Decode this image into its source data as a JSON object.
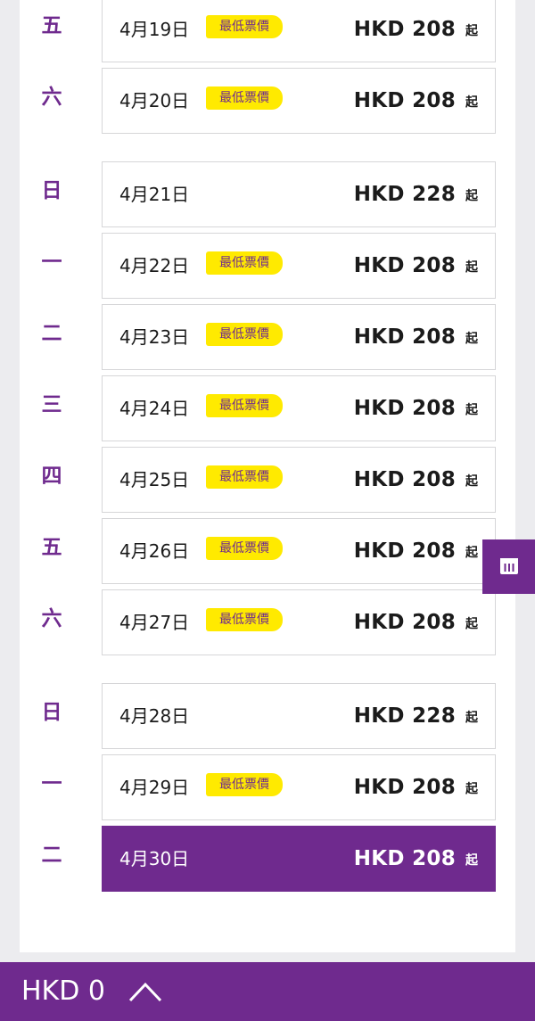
{
  "colors": {
    "brand": "#6f2a8e",
    "badge": "#ffea00",
    "page_bg": "#ececef",
    "card_border": "#d6d6d8"
  },
  "rows": [
    {
      "day": "五",
      "date": "4月19日",
      "badge": "最低票價",
      "price": "HKD 208",
      "suffix": "起"
    },
    {
      "day": "六",
      "date": "4月20日",
      "badge": "最低票價",
      "price": "HKD 208",
      "suffix": "起"
    },
    {
      "day": "日",
      "date": "4月21日",
      "badge": "",
      "price": "HKD 228",
      "suffix": "起"
    },
    {
      "day": "一",
      "date": "4月22日",
      "badge": "最低票價",
      "price": "HKD 208",
      "suffix": "起"
    },
    {
      "day": "二",
      "date": "4月23日",
      "badge": "最低票價",
      "price": "HKD 208",
      "suffix": "起"
    },
    {
      "day": "三",
      "date": "4月24日",
      "badge": "最低票價",
      "price": "HKD 208",
      "suffix": "起"
    },
    {
      "day": "四",
      "date": "4月25日",
      "badge": "最低票價",
      "price": "HKD 208",
      "suffix": "起"
    },
    {
      "day": "五",
      "date": "4月26日",
      "badge": "最低票價",
      "price": "HKD 208",
      "suffix": "起"
    },
    {
      "day": "六",
      "date": "4月27日",
      "badge": "最低票價",
      "price": "HKD 208",
      "suffix": "起"
    },
    {
      "day": "日",
      "date": "4月28日",
      "badge": "",
      "price": "HKD 228",
      "suffix": "起"
    },
    {
      "day": "一",
      "date": "4月29日",
      "badge": "最低票價",
      "price": "HKD 208",
      "suffix": "起"
    },
    {
      "day": "二",
      "date": "4月30日",
      "badge": "",
      "price": "HKD 208",
      "suffix": "起",
      "selected": true
    }
  ],
  "side_tab": {
    "icon": "calendar-columns-icon"
  },
  "bottom_bar": {
    "total": "HKD 0",
    "toggle_icon": "chevron-up-icon"
  }
}
